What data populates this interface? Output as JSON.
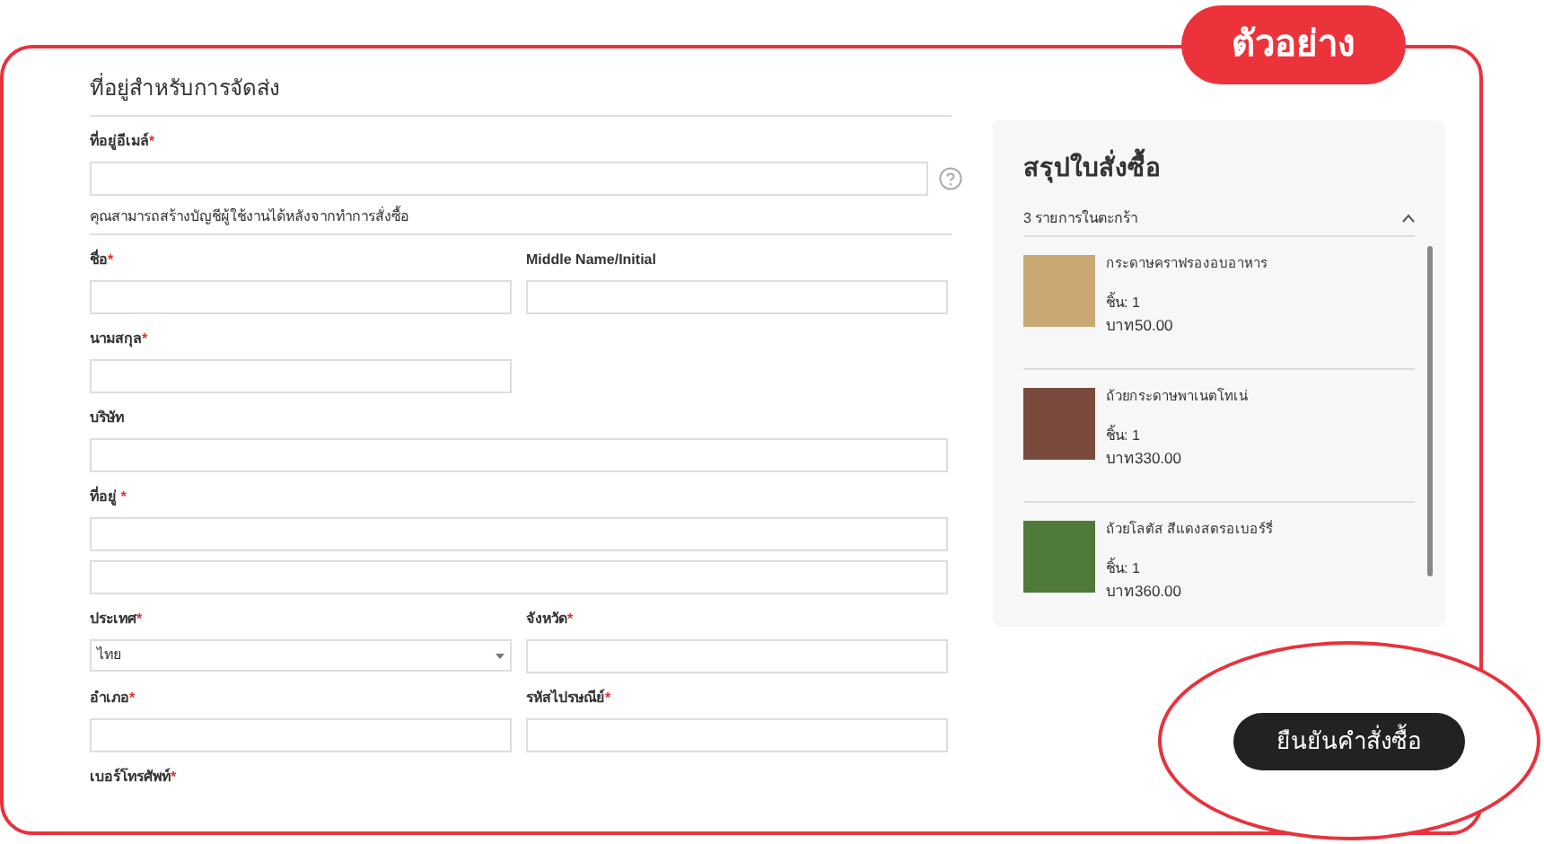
{
  "badge": "ตัวอย่าง",
  "form": {
    "title": "ที่อยู่สำหรับการจัดส่ง",
    "rows": [
      {
        "kind": "full",
        "fields": [
          {
            "kind": "email",
            "label": "ที่อยู่อีเมล์",
            "required_mark": "*",
            "help": "คุณสามารถสร้างบัญชีผู้ใช้งานได้หลังจากทำการสั่งซื้อ"
          }
        ]
      },
      {
        "kind": "two",
        "fields": [
          {
            "kind": "text",
            "label": "ชื่อ",
            "required_mark": "*"
          },
          {
            "kind": "text",
            "label": "Middle Name/Initial"
          }
        ]
      },
      {
        "kind": "half",
        "fields": [
          {
            "kind": "text",
            "label": "นามสกุล",
            "required_mark": "*"
          }
        ]
      },
      {
        "kind": "full",
        "fields": [
          {
            "kind": "text",
            "label": "บริษัท"
          }
        ]
      },
      {
        "kind": "full",
        "fields": [
          {
            "kind": "multiline",
            "label": "ที่อยู่ ",
            "required_mark": "*"
          }
        ]
      },
      {
        "kind": "two",
        "fields": [
          {
            "kind": "select",
            "label": "ประเทศ",
            "required_mark": "*",
            "value": "ไทย"
          },
          {
            "kind": "text",
            "label": "จังหวัด",
            "required_mark": "*"
          }
        ]
      },
      {
        "kind": "two",
        "fields": [
          {
            "kind": "text",
            "label": "อำเภอ",
            "required_mark": "*"
          },
          {
            "kind": "text",
            "label": "รหัสไปรษณีย์",
            "required_mark": "*"
          }
        ]
      },
      {
        "kind": "label",
        "fields": [
          {
            "label": "เบอร์โทรศัพท์",
            "required_mark": "*"
          }
        ]
      }
    ]
  },
  "summary": {
    "title": "สรุปใบสั่งซื้อ",
    "count": "3 รายการในตะกร้า",
    "expanded": true,
    "items": [
      {
        "name": "กระดาษคราฟรองอบอาหาร",
        "qty": "ชิ้น: 1",
        "price": "บาท50.00",
        "kind": "paper"
      },
      {
        "name": "ถ้วยกระดาษพาเนตโทเน่",
        "qty": "ชิ้น: 1",
        "price": "บาท330.00",
        "kind": "cup"
      },
      {
        "name": "ถ้วยโลตัส สีแดงสตรอเบอร์รี่",
        "qty": "ชิ้น: 1",
        "price": "บาท360.00",
        "kind": "lotus"
      }
    ]
  },
  "button": "ยืนยันคำสั่งซื้อ"
}
